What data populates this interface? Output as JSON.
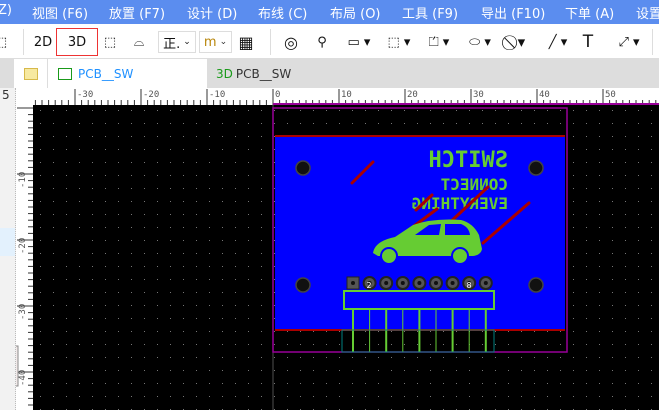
{
  "menu": {
    "items": [
      "Z)",
      "视图 (F6)",
      "放置 (F7)",
      "设计 (D)",
      "布线 (C)",
      "布局 (O)",
      "工具 (F9)",
      "导出 (F10)",
      "下单 (A)",
      "设置"
    ]
  },
  "toolbar": {
    "btn_2d": "2D",
    "btn_3d": "3D",
    "view_select": "正.",
    "unit_select": "m",
    "text_tool": "T",
    "active_view": "3D"
  },
  "tabs": [
    {
      "label": "PCB__SW",
      "icon": "pcb-icon"
    },
    {
      "label": "PCB__SW",
      "prefix": "3D"
    }
  ],
  "ruler": {
    "top_labels": [
      "-30",
      "-20",
      "-10",
      "0",
      "10",
      "20",
      "30",
      "40",
      "50"
    ],
    "left_labels": [
      "5",
      "-10",
      "-20",
      "-30",
      "-40"
    ]
  },
  "board": {
    "silk_lines": [
      "SWITCH",
      "CONNECT",
      "EVERYTHING"
    ],
    "pad_labels": [
      "2",
      "8"
    ],
    "colors": {
      "fill": "#0000ff",
      "silk": "#66cc33",
      "outline": "#990099",
      "edge": "#aa0000"
    }
  }
}
